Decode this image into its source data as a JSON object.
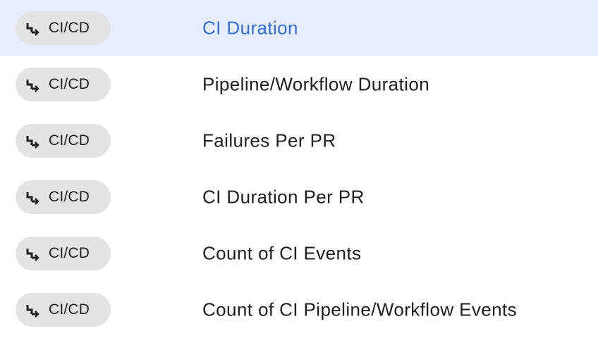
{
  "theme": {
    "selected_background": "#e8edfd",
    "selected_text": "#2f6fe4",
    "chip_background": "#e3e3e3"
  },
  "rows": [
    {
      "category": "CI/CD",
      "category_icon": "ci-cd-step-icon",
      "title": "CI Duration",
      "selected": true
    },
    {
      "category": "CI/CD",
      "category_icon": "ci-cd-step-icon",
      "title": "Pipeline/Workflow Duration",
      "selected": false
    },
    {
      "category": "CI/CD",
      "category_icon": "ci-cd-step-icon",
      "title": "Failures Per PR",
      "selected": false
    },
    {
      "category": "CI/CD",
      "category_icon": "ci-cd-step-icon",
      "title": "CI Duration Per PR",
      "selected": false
    },
    {
      "category": "CI/CD",
      "category_icon": "ci-cd-step-icon",
      "title": "Count of CI Events",
      "selected": false
    },
    {
      "category": "CI/CD",
      "category_icon": "ci-cd-step-icon",
      "title": "Count of CI Pipeline/Workflow Events",
      "selected": false
    }
  ]
}
